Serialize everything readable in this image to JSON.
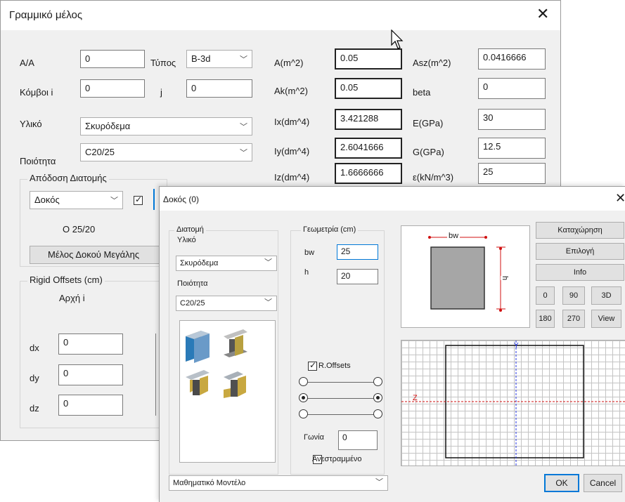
{
  "main": {
    "title": "Γραμμικό μέλος",
    "aa_label": "A/A",
    "aa_value": "0",
    "type_label": "Τύπος",
    "type_value": "B-3d",
    "nodes_label": "Κόμβοι i",
    "node_i_value": "0",
    "j_label": "j",
    "node_j_value": "0",
    "material_label": "Υλικό",
    "material_value": "Σκυρόδεμα",
    "quality_label": "Ποιότητα",
    "quality_value": "C20/25",
    "section_group": "Απόδοση Διατομής",
    "section_type": "Δοκός",
    "section_name": "O 25/20",
    "beam_button": "Μέλος Δοκού Μεγάλης",
    "offsets_group": "Rigid Offsets (cm)",
    "start_label": "Αρχή i",
    "dx_label": "dx",
    "dx_value": "0",
    "dy_label": "dy",
    "dy_value": "0",
    "dz_label": "dz",
    "dz_value": "0",
    "props": {
      "A_label": "A(m^2)",
      "A_value": "0.05",
      "Ak_label": "Ak(m^2)",
      "Ak_value": "0.05",
      "Ix_label": "Ix(dm^4)",
      "Ix_value": "3.421288",
      "Iy_label": "Iy(dm^4)",
      "Iy_value": "2.6041666",
      "Iz_label": "Iz(dm^4)",
      "Iz_value": "1.6666666",
      "Asz_label": "Asz(m^2)",
      "Asz_value": "0.0416666",
      "beta_label": "beta",
      "beta_value": "0",
      "E_label": "E(GPa)",
      "E_value": "30",
      "G_label": "G(GPa)",
      "G_value": "12.5",
      "eps_label": "ε(kN/m^3)",
      "eps_value": "25"
    }
  },
  "dialog": {
    "title": "Δοκός (0)",
    "section_label": "Διατομή",
    "material_label": "Υλικό",
    "material_value": "Σκυρόδεμα",
    "quality_label": "Ποιότητα",
    "quality_value": "C20/25",
    "geometry_label": "Γεωμετρία (cm)",
    "bw_label": "bw",
    "bw_value": "25",
    "h_label": "h",
    "h_value": "20",
    "roffsets_label": "R.Offsets",
    "angle_label": "Γωνία",
    "angle_value": "0",
    "inverted_label": "Ανεστραμμένο",
    "model_value": "Μαθηματικό Μοντέλο",
    "preview_bw": "bw",
    "preview_h": "h",
    "btn_save": "Καταχώρηση",
    "btn_select": "Επιλογή",
    "btn_info": "Info",
    "btn_0": "0",
    "btn_90": "90",
    "btn_3d": "3D",
    "btn_180": "180",
    "btn_270": "270",
    "btn_view": "View",
    "axis_y": "Y",
    "axis_z": "Z",
    "ok": "OK",
    "cancel": "Cancel"
  },
  "colors": {
    "accent": "#0078d7",
    "section_fill": "#a0a0a0",
    "dim_red": "#d01010",
    "axis_blue": "#2030e0"
  }
}
